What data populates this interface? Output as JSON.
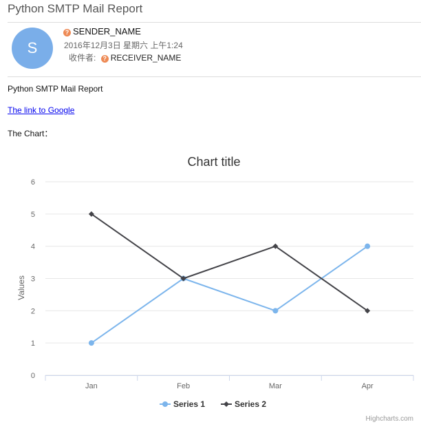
{
  "email": {
    "title": "Python SMTP Mail Report",
    "avatar_letter": "S",
    "sender_name": "SENDER_NAME",
    "date": "2016年12月3日 星期六 上午1:24",
    "receiver_label": "收件者:",
    "receiver_name": "RECEIVER_NAME",
    "body_heading": "Python SMTP Mail Report",
    "link_text": "The link to Google",
    "chart_intro": "The Chart："
  },
  "colors": {
    "series1": "#7cb5ec",
    "series2": "#434348",
    "grid": "#e6e6e6",
    "axis": "#ccd6eb",
    "avatar": "#7aaee9",
    "unknown_badge": "#ee8a55"
  },
  "icons": {
    "unknown_sender": "question-badge-icon",
    "unknown_receiver": "question-badge-icon"
  },
  "chart_data": {
    "type": "line",
    "title": "Chart title",
    "xlabel": "",
    "ylabel": "Values",
    "categories": [
      "Jan",
      "Feb",
      "Mar",
      "Apr"
    ],
    "ylim": [
      0,
      6
    ],
    "yticks": [
      0,
      1,
      2,
      3,
      4,
      5,
      6
    ],
    "grid": true,
    "legend_position": "bottom-center",
    "credits": "Highcharts.com",
    "series": [
      {
        "name": "Series 1",
        "values": [
          1,
          3,
          2,
          4
        ],
        "marker": "circle"
      },
      {
        "name": "Series 2",
        "values": [
          5,
          3,
          4,
          2
        ],
        "marker": "diamond"
      }
    ]
  }
}
